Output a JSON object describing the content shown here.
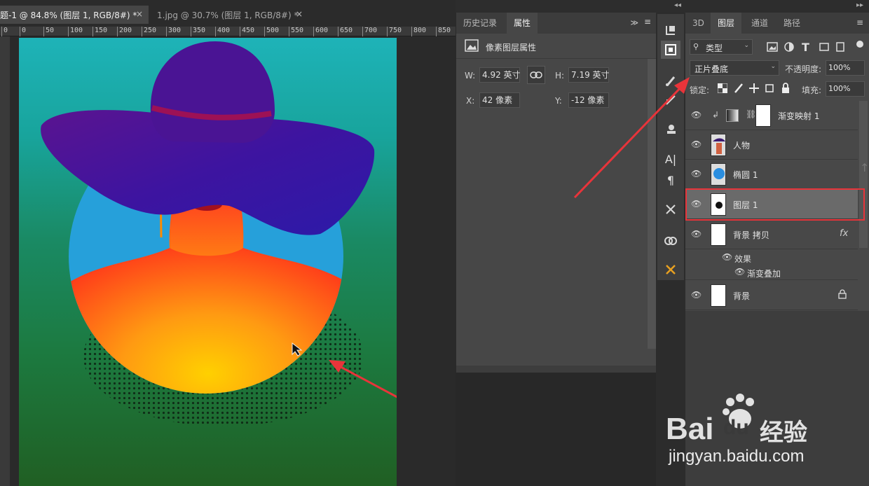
{
  "document_tabs": [
    {
      "title": "题-1 @ 84.8% (图层 1, RGB/8#) *",
      "close": "×"
    },
    {
      "title": "1.jpg @ 30.7% (图层 1, RGB/8#) *",
      "close": "×"
    }
  ],
  "ruler_ticks": [
    "0",
    "0",
    "50",
    "100",
    "150",
    "200",
    "250",
    "300",
    "350",
    "400",
    "450",
    "500",
    "550",
    "600",
    "650",
    "700",
    "750",
    "800",
    "850"
  ],
  "properties_panel": {
    "tabs": [
      "历史记录",
      "属性"
    ],
    "menu_glyph": "≫",
    "title": "像素图层属性",
    "w_label": "W:",
    "w_value": "4.92 英寸",
    "h_label": "H:",
    "h_value": "7.19 英寸",
    "x_label": "X:",
    "x_value": "42 像素",
    "y_label": "Y:",
    "y_value": "-12 像素"
  },
  "layers_panel": {
    "tabs": [
      "3D",
      "图层",
      "通道",
      "路径"
    ],
    "filter_label": "类型",
    "blend_mode": "正片叠底",
    "opacity_label": "不透明度:",
    "opacity_value": "100%",
    "lock_label": "锁定:",
    "fill_label": "填充:",
    "fill_value": "100%",
    "layers": [
      {
        "name": "渐变映射 1"
      },
      {
        "name": "人物"
      },
      {
        "name": "椭圆 1"
      },
      {
        "name": "图层 1"
      },
      {
        "name": "背景 拷贝"
      },
      {
        "name": "效果"
      },
      {
        "name": "渐变叠加"
      },
      {
        "name": "背景"
      }
    ],
    "fx_label": "fx"
  },
  "watermark": {
    "brand": "Bai",
    "brand2": "du",
    "cn": "经验",
    "url": "jingyan.baidu.com"
  },
  "colors": {
    "accent_red": "#e8343a",
    "selection": "#6a6a6a"
  }
}
